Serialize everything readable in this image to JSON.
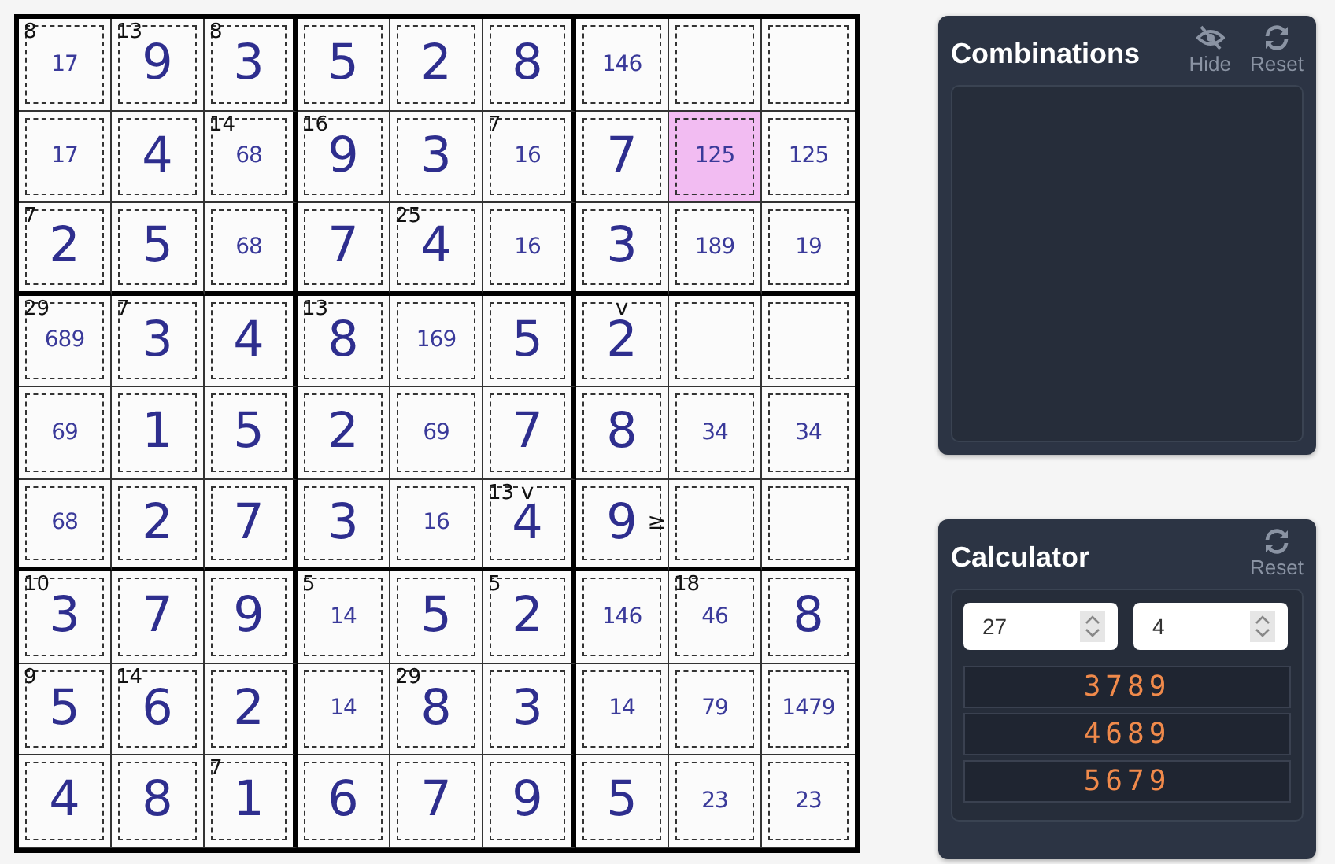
{
  "grid": {
    "rows": [
      [
        {
          "cage": "8",
          "candidates": "17",
          "selected": false
        },
        {
          "cage": "13",
          "value": "9",
          "selected": false
        },
        {
          "cage": "8",
          "value": "3",
          "selected": false
        },
        {
          "value": "5",
          "selected": false
        },
        {
          "value": "2",
          "selected": false
        },
        {
          "value": "8",
          "selected": false
        },
        {
          "candidates": "146",
          "selected": false
        },
        {
          "selected": false
        },
        {
          "selected": false
        }
      ],
      [
        {
          "candidates": "17",
          "selected": false
        },
        {
          "value": "4",
          "selected": false
        },
        {
          "cage": "14",
          "candidates": "68",
          "selected": false
        },
        {
          "cage": "16",
          "value": "9",
          "selected": false
        },
        {
          "value": "3",
          "selected": false
        },
        {
          "cage": "7",
          "candidates": "16",
          "selected": false
        },
        {
          "value": "7",
          "selected": false
        },
        {
          "candidates": "125",
          "selected": true
        },
        {
          "candidates": "125",
          "selected": false
        }
      ],
      [
        {
          "cage": "7",
          "value": "2",
          "selected": false
        },
        {
          "value": "5",
          "selected": false
        },
        {
          "candidates": "68",
          "selected": false
        },
        {
          "value": "7",
          "selected": false
        },
        {
          "cage": "25",
          "value": "4",
          "selected": false
        },
        {
          "candidates": "16",
          "selected": false
        },
        {
          "value": "3",
          "selected": false
        },
        {
          "candidates": "189",
          "selected": false
        },
        {
          "candidates": "19",
          "selected": false
        }
      ],
      [
        {
          "cage": "29",
          "candidates": "689",
          "selected": false
        },
        {
          "cage": "7",
          "value": "3",
          "selected": false
        },
        {
          "value": "4",
          "selected": false
        },
        {
          "cage": "13",
          "value": "8",
          "selected": false
        },
        {
          "candidates": "169",
          "selected": false
        },
        {
          "value": "5",
          "selected": false
        },
        {
          "value": "2",
          "sign": "v",
          "selected": false
        },
        {
          "selected": false
        },
        {
          "selected": false
        }
      ],
      [
        {
          "candidates": "69",
          "selected": false
        },
        {
          "value": "1",
          "selected": false
        },
        {
          "value": "5",
          "selected": false
        },
        {
          "value": "2",
          "selected": false
        },
        {
          "candidates": "69",
          "selected": false
        },
        {
          "value": "7",
          "selected": false
        },
        {
          "value": "8",
          "selected": false
        },
        {
          "candidates": "34",
          "selected": false
        },
        {
          "candidates": "34",
          "selected": false
        }
      ],
      [
        {
          "candidates": "68",
          "selected": false
        },
        {
          "value": "2",
          "selected": false
        },
        {
          "value": "7",
          "selected": false
        },
        {
          "value": "3",
          "selected": false
        },
        {
          "candidates": "16",
          "selected": false
        },
        {
          "cage": "13",
          "value": "4",
          "sign": "v",
          "selected": false
        },
        {
          "value": "9",
          "sign_right": "≥",
          "selected": false
        },
        {
          "selected": false
        },
        {
          "selected": false
        }
      ],
      [
        {
          "cage": "10",
          "value": "3",
          "selected": false
        },
        {
          "value": "7",
          "selected": false
        },
        {
          "value": "9",
          "selected": false
        },
        {
          "cage": "5",
          "candidates": "14",
          "selected": false
        },
        {
          "value": "5",
          "selected": false
        },
        {
          "cage": "5",
          "value": "2",
          "selected": false
        },
        {
          "candidates": "146",
          "selected": false
        },
        {
          "cage": "18",
          "candidates": "46",
          "selected": false
        },
        {
          "value": "8",
          "selected": false
        }
      ],
      [
        {
          "cage": "9",
          "value": "5",
          "selected": false
        },
        {
          "cage": "14",
          "value": "6",
          "selected": false
        },
        {
          "value": "2",
          "selected": false
        },
        {
          "candidates": "14",
          "selected": false
        },
        {
          "cage": "29",
          "value": "8",
          "selected": false
        },
        {
          "value": "3",
          "selected": false
        },
        {
          "candidates": "14",
          "selected": false
        },
        {
          "candidates": "79",
          "selected": false
        },
        {
          "candidates": "1479",
          "selected": false
        }
      ],
      [
        {
          "value": "4",
          "selected": false
        },
        {
          "value": "8",
          "selected": false
        },
        {
          "cage": "7",
          "value": "1",
          "selected": false
        },
        {
          "value": "6",
          "selected": false
        },
        {
          "value": "7",
          "selected": false
        },
        {
          "value": "9",
          "selected": false
        },
        {
          "value": "5",
          "selected": false
        },
        {
          "candidates": "23",
          "selected": false
        },
        {
          "candidates": "23",
          "selected": false
        }
      ]
    ]
  },
  "combinations": {
    "title": "Combinations",
    "hide_label": "Hide",
    "reset_label": "Reset"
  },
  "calculator": {
    "title": "Calculator",
    "reset_label": "Reset",
    "sum": "27",
    "count": "4",
    "results": [
      "3789",
      "4689",
      "5679"
    ]
  }
}
